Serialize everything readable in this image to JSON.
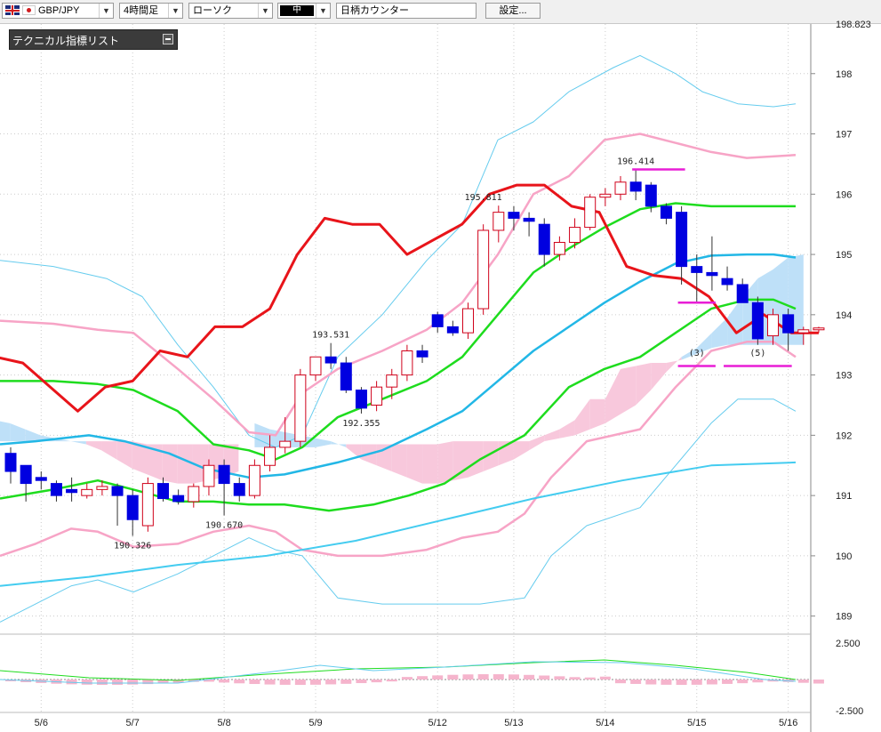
{
  "toolbar": {
    "pair": "GBP/JPY",
    "timeframe": "4時間足",
    "chart_type": "ローソク",
    "color_label": "中",
    "symbol_counter": "日柄カウンター",
    "settings_label": "設定..."
  },
  "indicator_panel": {
    "title": "テクニカル指標リスト"
  },
  "colors": {
    "bull_candle": "#d0021b",
    "bear_candle": "#0000e0",
    "red_line": "#e8141a",
    "green_line": "#1edc1e",
    "pink_band": "#f7a4c6",
    "light_blue_band": "#66ccee",
    "cloud_blue": "#bee0f8",
    "cloud_pink": "#f8c8dc",
    "magenta": "#e81ed6"
  },
  "chart_data": {
    "type": "candlestick",
    "ylim": [
      188.7,
      198.823
    ],
    "y_ticks": [
      "198",
      "197",
      "196",
      "195",
      "194",
      "193",
      "192",
      "191",
      "190",
      "189"
    ],
    "top_price_label": "198.823",
    "x_tick_labels": [
      "5/6",
      "5/7",
      "5/8",
      "5/9",
      "5/12",
      "5/13",
      "5/14",
      "5/15",
      "5/16"
    ],
    "x_tick_index": [
      2,
      8,
      14,
      20,
      28,
      33,
      39,
      45,
      51
    ],
    "annotations": [
      {
        "text": "190.326",
        "index": 8,
        "price": 190.33
      },
      {
        "text": "190.670",
        "index": 14,
        "price": 190.67
      },
      {
        "text": "193.531",
        "index": 21,
        "price": 193.53
      },
      {
        "text": "192.355",
        "index": 23,
        "price": 192.36
      },
      {
        "text": "195.811",
        "index": 31,
        "price": 195.81
      },
      {
        "text": "196.414",
        "index": 41,
        "price": 196.41
      },
      {
        "text": "(3)",
        "index": 45,
        "price": 193.35
      },
      {
        "text": "(5)",
        "index": 49,
        "price": 193.35
      }
    ],
    "candles": [
      [
        191.7,
        191.8,
        191.2,
        191.4
      ],
      [
        191.5,
        191.5,
        190.9,
        191.2
      ],
      [
        191.3,
        191.4,
        191.1,
        191.25
      ],
      [
        191.2,
        191.25,
        190.9,
        191.0
      ],
      [
        191.1,
        191.3,
        190.9,
        191.05
      ],
      [
        191.0,
        191.2,
        190.95,
        191.1
      ],
      [
        191.1,
        191.25,
        191.0,
        191.15
      ],
      [
        191.15,
        191.2,
        190.5,
        191.0
      ],
      [
        191.0,
        191.1,
        190.33,
        190.6
      ],
      [
        190.5,
        191.3,
        190.4,
        191.2
      ],
      [
        191.2,
        191.3,
        190.9,
        190.95
      ],
      [
        191.0,
        191.1,
        190.85,
        190.9
      ],
      [
        190.9,
        191.2,
        190.8,
        191.15
      ],
      [
        191.15,
        191.6,
        191.0,
        191.5
      ],
      [
        191.5,
        191.6,
        190.67,
        191.2
      ],
      [
        191.2,
        191.3,
        190.9,
        191.0
      ],
      [
        191.0,
        191.6,
        190.95,
        191.5
      ],
      [
        191.5,
        192.0,
        191.4,
        191.8
      ],
      [
        191.8,
        192.3,
        191.7,
        191.9
      ],
      [
        191.9,
        193.1,
        191.8,
        193.0
      ],
      [
        193.0,
        193.3,
        192.9,
        193.3
      ],
      [
        193.3,
        193.53,
        193.1,
        193.2
      ],
      [
        193.2,
        193.3,
        192.7,
        192.75
      ],
      [
        192.75,
        192.8,
        192.36,
        192.45
      ],
      [
        192.5,
        192.9,
        192.4,
        192.8
      ],
      [
        192.8,
        193.1,
        192.6,
        193.0
      ],
      [
        193.0,
        193.5,
        192.9,
        193.4
      ],
      [
        193.4,
        193.5,
        193.2,
        193.3
      ],
      [
        194.0,
        194.05,
        193.7,
        193.8
      ],
      [
        193.8,
        193.9,
        193.65,
        193.7
      ],
      [
        193.7,
        194.2,
        193.6,
        194.1
      ],
      [
        194.1,
        195.5,
        194.0,
        195.4
      ],
      [
        195.4,
        195.81,
        195.2,
        195.7
      ],
      [
        195.7,
        195.8,
        195.4,
        195.6
      ],
      [
        195.6,
        195.7,
        195.3,
        195.55
      ],
      [
        195.5,
        195.6,
        194.8,
        195.0
      ],
      [
        195.0,
        195.3,
        194.9,
        195.2
      ],
      [
        195.2,
        195.6,
        195.1,
        195.45
      ],
      [
        195.45,
        196.0,
        195.4,
        195.95
      ],
      [
        195.95,
        196.1,
        195.8,
        196.0
      ],
      [
        196.0,
        196.3,
        195.9,
        196.2
      ],
      [
        196.2,
        196.41,
        195.9,
        196.05
      ],
      [
        196.15,
        196.2,
        195.7,
        195.8
      ],
      [
        195.8,
        195.85,
        195.5,
        195.6
      ],
      [
        195.7,
        195.8,
        194.5,
        194.8
      ],
      [
        194.8,
        195.0,
        194.2,
        194.7
      ],
      [
        194.7,
        195.3,
        194.4,
        194.65
      ],
      [
        194.6,
        194.8,
        194.4,
        194.5
      ],
      [
        194.5,
        194.6,
        194.2,
        194.2
      ],
      [
        194.2,
        194.3,
        193.5,
        193.6
      ],
      [
        193.65,
        194.1,
        193.5,
        194.0
      ],
      [
        194.0,
        194.1,
        193.4,
        193.7
      ],
      [
        193.7,
        193.8,
        193.5,
        193.75
      ],
      [
        193.75,
        193.8,
        193.7,
        193.78
      ]
    ],
    "red_line": [
      193.3,
      193.2,
      192.8,
      192.4,
      192.8,
      192.9,
      193.4,
      193.3,
      193.8,
      193.8,
      194.1,
      195.0,
      195.6,
      195.5,
      195.5,
      195.0,
      195.25,
      195.5,
      196.0,
      196.15,
      196.15,
      195.8,
      195.7,
      194.8,
      194.65,
      194.6,
      194.3,
      193.7,
      194.0,
      193.7,
      193.7
    ],
    "red_line_start": -1
  }
}
